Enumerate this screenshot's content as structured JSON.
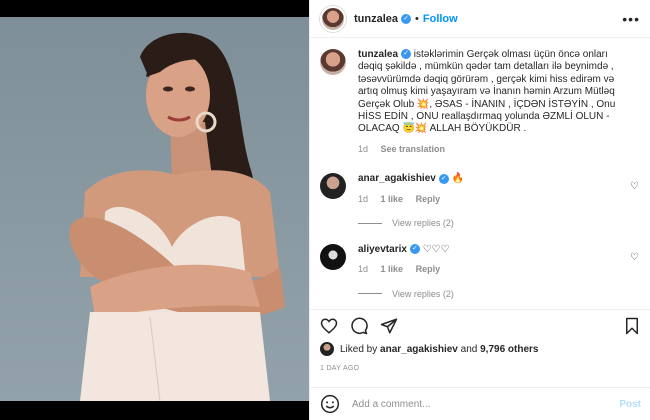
{
  "header": {
    "username": "tunzalea",
    "follow_label": "Follow",
    "more_label": "•••",
    "separator": "•"
  },
  "caption": {
    "username": "tunzalea",
    "text": "istəklərimin Gerçək olması üçün öncə onları dəqiq şəkildə , mümkün qədər tam detalları ilə beynimdə , təsəvvürümdə dəqiq görürəm , gerçək kimi hiss edirəm və artıq olmuş kimi yaşayıram və İnanın həmin Arzum Mütləq Gerçək Olub 💥, ƏSAS - İNANIN , İÇDƏN İSTƏYİN , Onu HİSS EDİN , ONU reallaşdırmaq yolunda ƏZMLİ OLUN - OLACAQ 😇💥 ALLAH BÖYÜKDÜR .",
    "time": "1d",
    "see_translation": "See translation"
  },
  "comments": [
    {
      "username": "anar_agakishiev",
      "text": "🔥",
      "time": "1d",
      "likes": "1 like",
      "reply": "Reply",
      "view_replies": "View replies (2)"
    },
    {
      "username": "aliyevtarix",
      "text": "♡♡♡",
      "time": "1d",
      "likes": "1 like",
      "reply": "Reply",
      "view_replies": "View replies (2)"
    }
  ],
  "likes": {
    "prefix": "Liked by",
    "by": "anar_agakishiev",
    "and": "and",
    "others": "9,796 others"
  },
  "time_ago": "1 DAY AGO",
  "add_comment": {
    "placeholder": "Add a comment...",
    "post_label": "Post"
  },
  "icons": {
    "like": "heart-icon",
    "comment": "comment-icon",
    "share": "share-icon",
    "save": "bookmark-icon",
    "emoji": "emoji-icon",
    "verified": "verified-badge-icon"
  },
  "colors": {
    "accent": "#0095f6",
    "verified": "#3897f0",
    "muted": "#8e8e8e",
    "text": "#262626"
  }
}
